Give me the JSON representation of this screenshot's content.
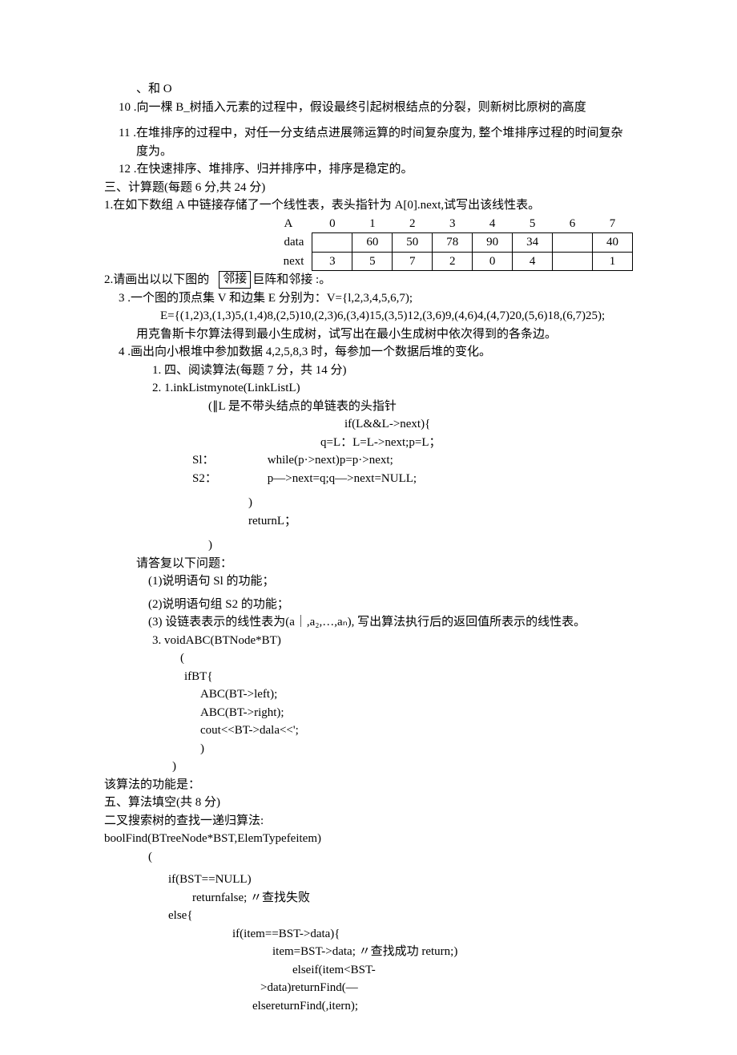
{
  "pre_items": {
    "frag": "、和 O",
    "q10": "10  .向一棵 B_树插入元素的过程中，假设最终引起树根结点的分裂，则新树比原树的高度",
    "q11": "11  .在堆排序的过程中，对任一分支结点进展筛运算的时间复杂度为, 整个堆排序过程的时间复杂度为。",
    "q12": "12  .在快速排序、堆排序、归并排序中，排序是稳定的。"
  },
  "section3_title": "三、计算题(每题 6 分,共 24 分)",
  "q3_1": {
    "text": "1.在如下数组 A 中链接存储了一个线性表，表头指针为 A[0].next,试写出该线性表。",
    "headers": [
      "A",
      "0",
      "1",
      "2",
      "3",
      "4",
      "5",
      "6",
      "7"
    ],
    "row_data_label": "data",
    "row_data": [
      "",
      "60",
      "50",
      "78",
      "90",
      "34",
      "",
      "40"
    ],
    "row_next_label": "next",
    "row_next": [
      "3",
      "5",
      "7",
      "2",
      "0",
      "4",
      "",
      "1"
    ]
  },
  "q3_2": {
    "prefix": "2.请画出以以下图的",
    "box": "邻接",
    "suffix": "巨阵和邻接 :。"
  },
  "q3_3": {
    "l1": "3  .一个图的顶点集 V 和边集 E 分别为：V={l,2,3,4,5,6,7);",
    "l2": "E={(1,2)3,(1,3)5,(1,4)8,(2,5)10,(2,3)6,(3,4)15,(3,5)12,(3,6)9,(4,6)4,(4,7)20,(5,6)18,(6,7)25);",
    "l3": "用克鲁斯卡尔算法得到最小生成树，试写出在最小生成树中依次得到的各条边。"
  },
  "q3_4": "4  .画出向小根堆中参加数据 4,2,5,8,3 时，每参加一个数据后堆的变化。",
  "section4": {
    "n1": "1.   四、阅读算法(每题 7 分，共 14 分)",
    "n2": "2.   1.inkListmynote(LinkListL)",
    "c1": "(∥L 是不带头结点的单链表的头指针",
    "c2": "if(L&&L->next){",
    "c3": "q=L：L=L->next;p=L；",
    "s1lbl": "Sl：",
    "s1": "while(p·>next)p=p·>next;",
    "s2lbl": "S2：",
    "s2": "p—>next=q;q—>next=NULL;",
    "cb": ")",
    "ret": "returnL；",
    "cb2": ")",
    "ans": "请答复以下问题：",
    "a1": "(1)说明语句 Sl 的功能；",
    "a2": "(2)说明语句组 S2 的功能；",
    "a3": "(3) 设链表表示的线性表为(a｜,a₂,…,aₙ), 写出算法执行后的返回值所表示的线性表。",
    "n3": "3.   voidABC(BTNode*BT)",
    "p0": "(",
    "p1": "ifBT{",
    "p2": "ABC(BT->left);",
    "p3": "ABC(BT->right);",
    "p4": "cout<<BT->dala<<';",
    "p5": ")",
    "p6": ")",
    "func": "该算法的功能是："
  },
  "section5": {
    "title": "五、算法填空(共 8 分)",
    "sub": "二叉搜索树的查找一递归算法:",
    "sig": "boolFind(BTreeNode*BST,ElemTypefeitem)",
    "b0": "(",
    "b1": "if(BST==NULL)",
    "b2": "returnfalse; 〃查找失败",
    "b3": "else{",
    "b4": "if(item==BST->data){",
    "b5": "item=BST->data; 〃查找成功 return;)",
    "b6": "elseif(item<BST-",
    "b7": ">data)returnFind(—",
    "b8": "elsereturnFind(,itern);"
  }
}
